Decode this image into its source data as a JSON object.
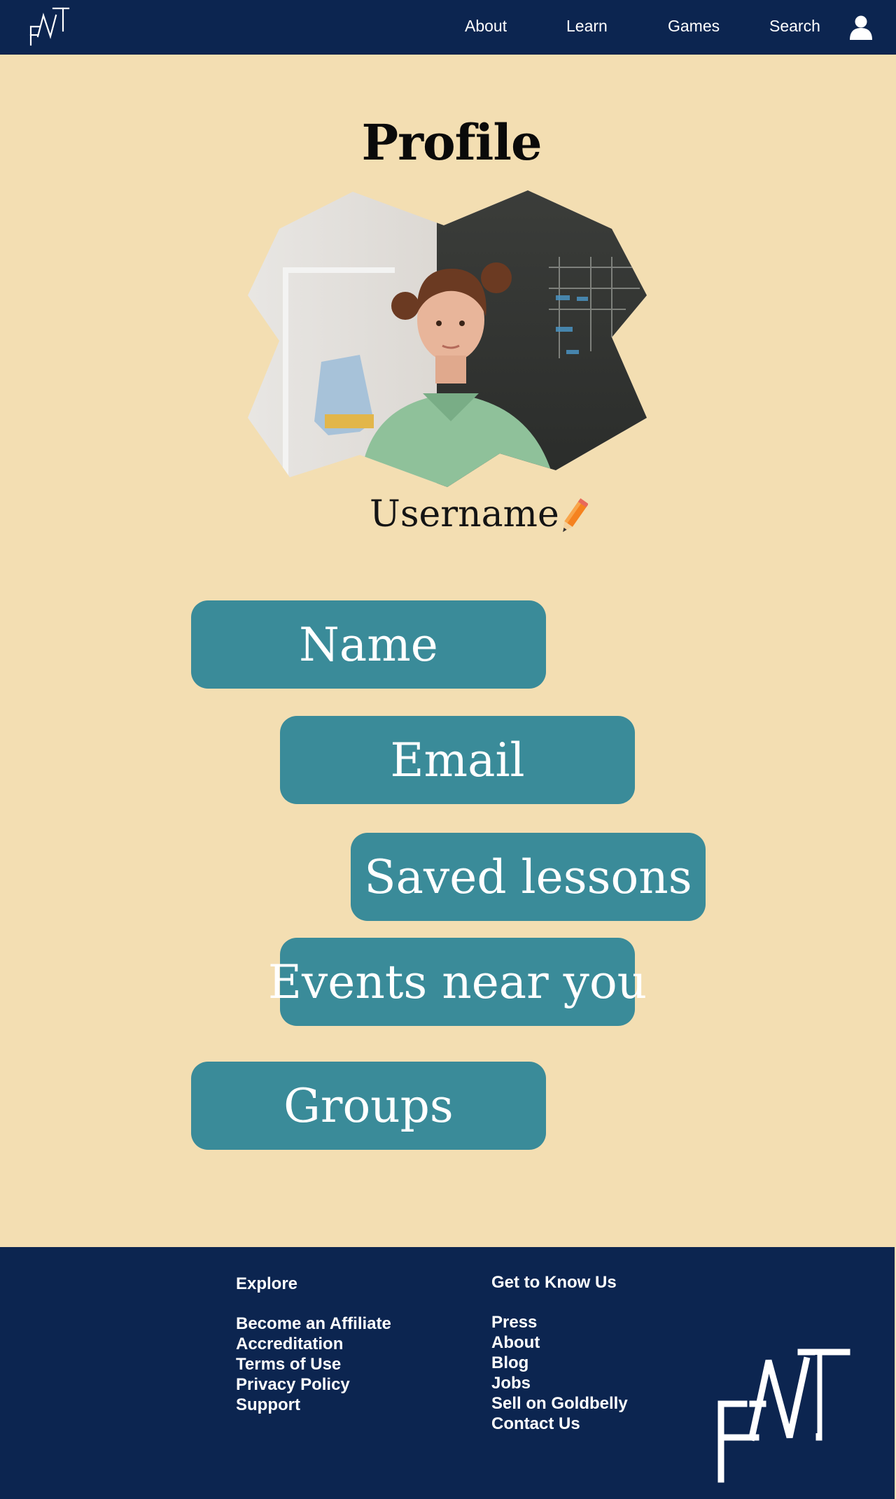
{
  "nav": {
    "logo_icon": "fmt-monogram-logo",
    "links": [
      "About",
      "Learn",
      "Games",
      "Search"
    ],
    "user_icon": "user-icon"
  },
  "profile": {
    "title": "Profile",
    "avatar_alt": "profile photo",
    "username": "Username",
    "edit_icon": "pencil-icon"
  },
  "menu": [
    "Name",
    "Email",
    "Saved lessons",
    "Events near you",
    "Groups"
  ],
  "footer": {
    "explore_heading": "Explore",
    "explore_links": [
      "Become an Affiliate",
      "Accreditation",
      "Terms of Use",
      "Privacy Policy",
      "Support"
    ],
    "know_heading": "Get to Know Us",
    "know_links": [
      "Press",
      "About",
      "Blog",
      "Jobs",
      "Sell on Goldbelly",
      "Contact Us"
    ]
  },
  "colors": {
    "navy": "#0c2550",
    "background": "#f3deb2",
    "teal_button": "#3a8b99",
    "text_white": "#ffffff"
  }
}
